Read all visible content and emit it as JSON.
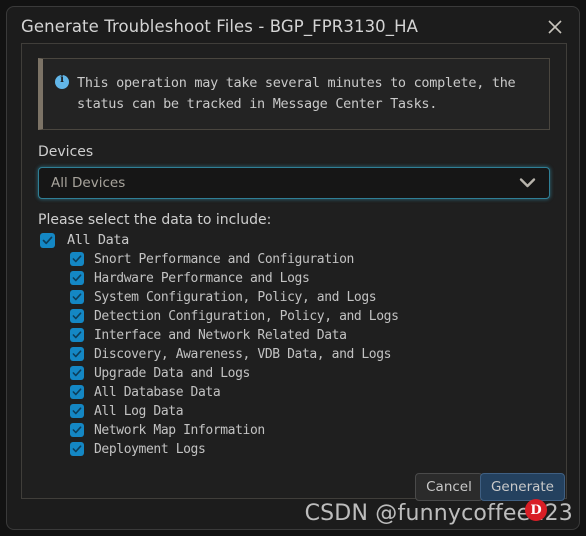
{
  "dialog": {
    "title": "Generate Troubleshoot Files - BGP_FPR3130_HA",
    "close_icon": "close-icon"
  },
  "info_banner": {
    "icon": "info-circle-icon",
    "message": "This operation may take several minutes to complete, the status can be tracked in Message Center Tasks.",
    "accent_color": "#7c7366",
    "icon_color": "#62b6e8"
  },
  "devices": {
    "label": "Devices",
    "selected": "All Devices",
    "placeholder": "All Devices",
    "chevron_icon": "chevron-down-icon",
    "focus_border_color": "#2f7f96"
  },
  "data_selection": {
    "prompt": "Please select the data to include:",
    "root": {
      "label": "All Data",
      "checked": true
    },
    "items": [
      {
        "label": "Snort Performance and Configuration",
        "checked": true
      },
      {
        "label": "Hardware Performance and Logs",
        "checked": true
      },
      {
        "label": "System Configuration, Policy, and Logs",
        "checked": true
      },
      {
        "label": "Detection Configuration, Policy, and Logs",
        "checked": true
      },
      {
        "label": "Interface and Network Related Data",
        "checked": true
      },
      {
        "label": "Discovery, Awareness, VDB Data, and Logs",
        "checked": true
      },
      {
        "label": "Upgrade Data and Logs",
        "checked": true
      },
      {
        "label": "All Database Data",
        "checked": true
      },
      {
        "label": "All Log Data",
        "checked": true
      },
      {
        "label": "Network Map Information",
        "checked": true
      },
      {
        "label": "Deployment Logs",
        "checked": true
      }
    ],
    "checkbox_color": "#1487c4"
  },
  "footer": {
    "cancel_label": "Cancel",
    "generate_label": "Generate",
    "generate_color": "#24415f"
  },
  "watermark": {
    "text": "CSDN @funnycoffee123",
    "badge_text": "D",
    "badge_color": "#d81e26"
  }
}
